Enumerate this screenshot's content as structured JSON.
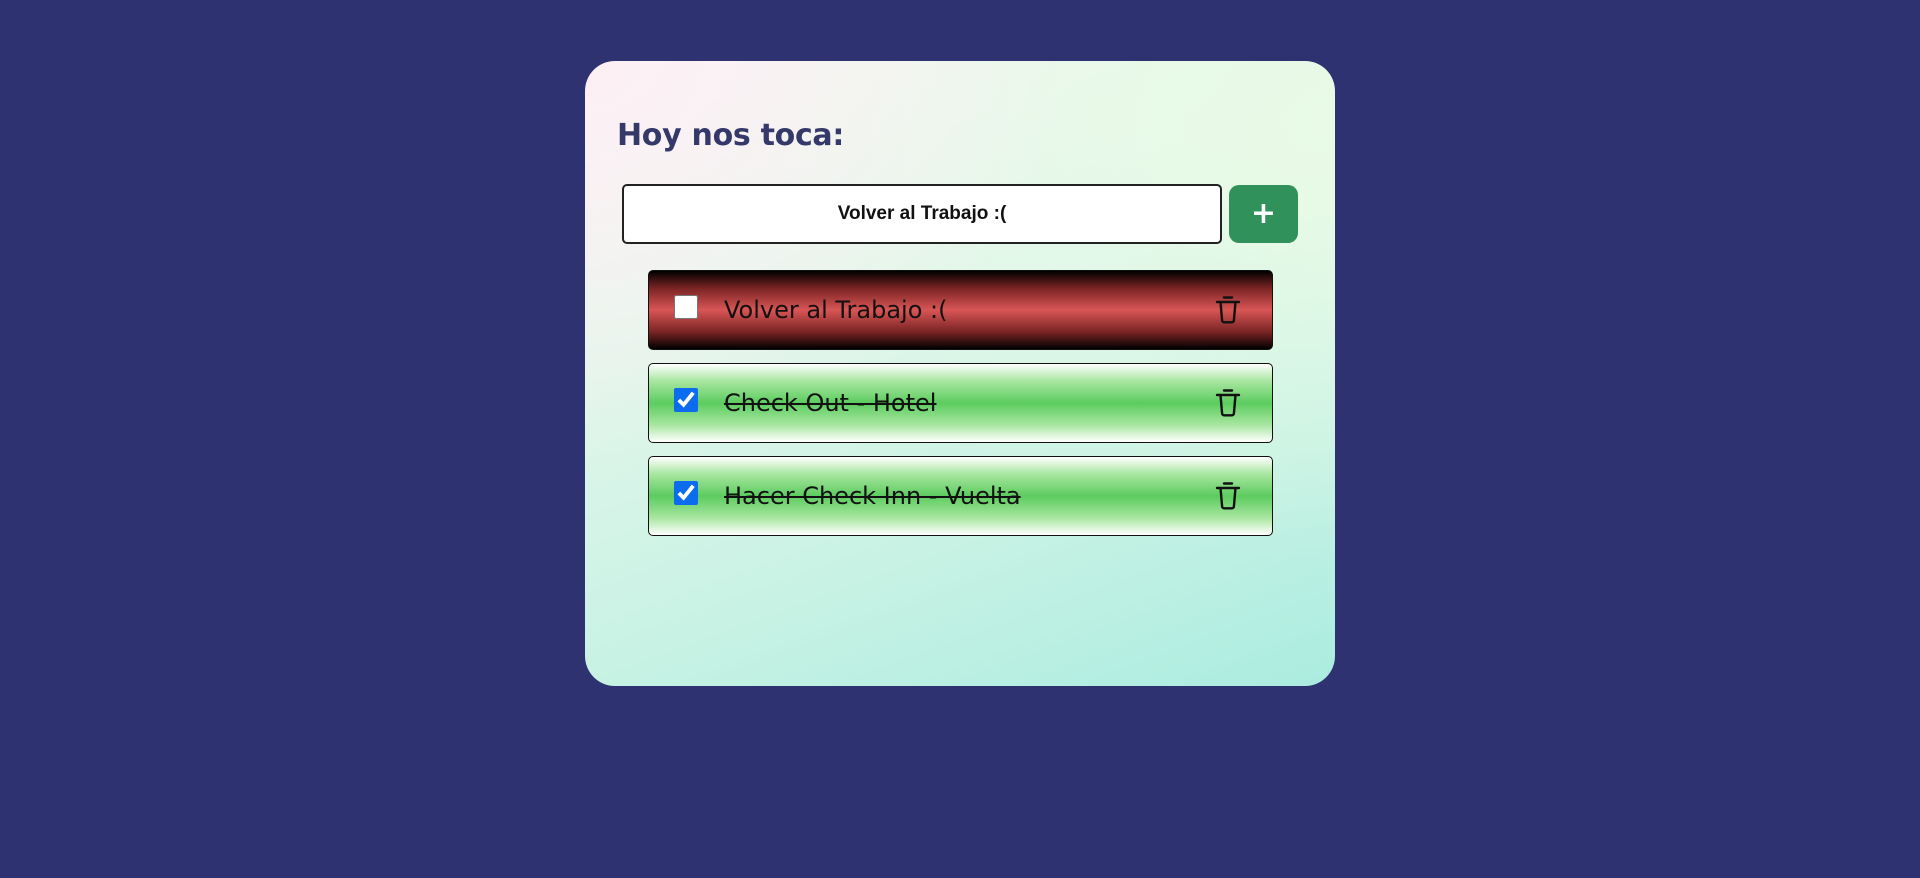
{
  "header": {
    "title": "Hoy nos toca:"
  },
  "new_task": {
    "value": "Volver al Trabajo :(",
    "add_label": "+"
  },
  "tasks": [
    {
      "label": "Volver al Trabajo :(",
      "done": false,
      "delete_icon": "trash-icon"
    },
    {
      "label": "Check Out - Hotel",
      "done": true,
      "delete_icon": "trash-icon"
    },
    {
      "label": "Hacer Check Inn - Vuelta",
      "done": true,
      "delete_icon": "trash-icon"
    }
  ],
  "colors": {
    "background": "#2e3270",
    "title": "#35396a",
    "add_button": "#31915b",
    "pending_task": "#d95555",
    "done_task": "#5ccc5f",
    "checkbox_accent": "#0b6cf0"
  }
}
